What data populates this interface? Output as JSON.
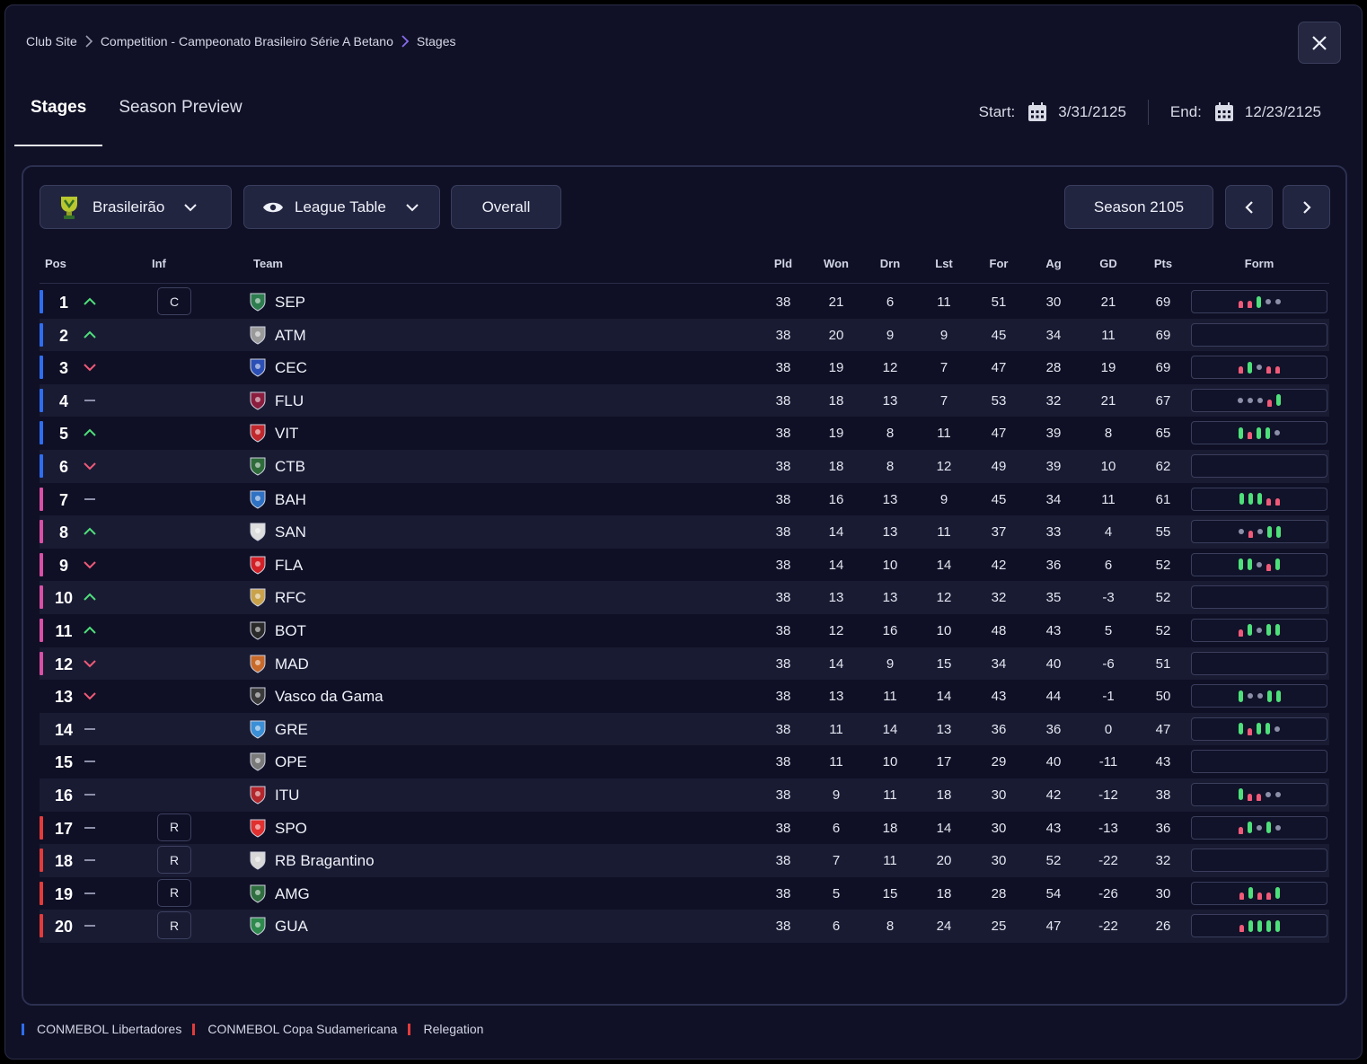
{
  "breadcrumb": [
    "Club Site",
    "Competition - Campeonato Brasileiro Série A Betano",
    "Stages"
  ],
  "tabs": [
    "Stages",
    "Season Preview"
  ],
  "dates": {
    "start_label": "Start:",
    "start": "3/31/2125",
    "end_label": "End:",
    "end": "12/23/2125"
  },
  "controls": {
    "competition": "Brasileirão",
    "view": "League Table",
    "scope": "Overall",
    "season": "Season 2105"
  },
  "columns": {
    "pos": "Pos",
    "inf": "Inf",
    "team": "Team",
    "pld": "Pld",
    "won": "Won",
    "drn": "Drn",
    "lst": "Lst",
    "for": "For",
    "ag": "Ag",
    "gd": "GD",
    "pts": "Pts",
    "form": "Form"
  },
  "colors": {
    "libertadores": "#2f6df0",
    "sudamericana": "#d94fa6",
    "relegation": "#e23b3b",
    "win": "#4ee07a",
    "loss": "#f05a78",
    "draw": "#8c8fa8"
  },
  "rows": [
    {
      "pos": "1",
      "trend": "up",
      "inf": "C",
      "team": "SEP",
      "crest": "#2e7d4f",
      "zone": "lib",
      "pld": "38",
      "won": "21",
      "drn": "6",
      "lst": "11",
      "for": "51",
      "ag": "30",
      "gd": "21",
      "pts": "69",
      "form": "LLWDD"
    },
    {
      "pos": "2",
      "trend": "up",
      "inf": "",
      "team": "ATM",
      "crest": "#9a9a9a",
      "zone": "lib",
      "pld": "38",
      "won": "20",
      "drn": "9",
      "lst": "9",
      "for": "45",
      "ag": "34",
      "gd": "11",
      "pts": "69",
      "form": ""
    },
    {
      "pos": "3",
      "trend": "down",
      "inf": "",
      "team": "CEC",
      "crest": "#2b4fb5",
      "zone": "lib",
      "pld": "38",
      "won": "19",
      "drn": "12",
      "lst": "7",
      "for": "47",
      "ag": "28",
      "gd": "19",
      "pts": "69",
      "form": "LWDLL"
    },
    {
      "pos": "4",
      "trend": "same",
      "inf": "",
      "team": "FLU",
      "crest": "#8b1e3f",
      "zone": "lib",
      "pld": "38",
      "won": "18",
      "drn": "13",
      "lst": "7",
      "for": "53",
      "ag": "32",
      "gd": "21",
      "pts": "67",
      "form": "DDDLW"
    },
    {
      "pos": "5",
      "trend": "up",
      "inf": "",
      "team": "VIT",
      "crest": "#c0282d",
      "zone": "lib",
      "pld": "38",
      "won": "19",
      "drn": "8",
      "lst": "11",
      "for": "47",
      "ag": "39",
      "gd": "8",
      "pts": "65",
      "form": "WLWWD"
    },
    {
      "pos": "6",
      "trend": "down",
      "inf": "",
      "team": "CTB",
      "crest": "#2e6b3a",
      "zone": "lib",
      "pld": "38",
      "won": "18",
      "drn": "8",
      "lst": "12",
      "for": "49",
      "ag": "39",
      "gd": "10",
      "pts": "62",
      "form": ""
    },
    {
      "pos": "7",
      "trend": "same",
      "inf": "",
      "team": "BAH",
      "crest": "#2f72c4",
      "zone": "sud",
      "pld": "38",
      "won": "16",
      "drn": "13",
      "lst": "9",
      "for": "45",
      "ag": "34",
      "gd": "11",
      "pts": "61",
      "form": "WWWLL"
    },
    {
      "pos": "8",
      "trend": "up",
      "inf": "",
      "team": "SAN",
      "crest": "#dddddd",
      "zone": "sud",
      "pld": "38",
      "won": "14",
      "drn": "13",
      "lst": "11",
      "for": "37",
      "ag": "33",
      "gd": "4",
      "pts": "55",
      "form": "DLDWW"
    },
    {
      "pos": "9",
      "trend": "down",
      "inf": "",
      "team": "FLA",
      "crest": "#d32027",
      "zone": "sud",
      "pld": "38",
      "won": "14",
      "drn": "10",
      "lst": "14",
      "for": "42",
      "ag": "36",
      "gd": "6",
      "pts": "52",
      "form": "WWDLW"
    },
    {
      "pos": "10",
      "trend": "up",
      "inf": "",
      "team": "RFC",
      "crest": "#c9a24a",
      "zone": "sud",
      "pld": "38",
      "won": "13",
      "drn": "13",
      "lst": "12",
      "for": "32",
      "ag": "35",
      "gd": "-3",
      "pts": "52",
      "form": ""
    },
    {
      "pos": "11",
      "trend": "up",
      "inf": "",
      "team": "BOT",
      "crest": "#2a2a2a",
      "zone": "sud",
      "pld": "38",
      "won": "12",
      "drn": "16",
      "lst": "10",
      "for": "48",
      "ag": "43",
      "gd": "5",
      "pts": "52",
      "form": "LWDWW"
    },
    {
      "pos": "12",
      "trend": "down",
      "inf": "",
      "team": "MAD",
      "crest": "#c86a2a",
      "zone": "sud",
      "pld": "38",
      "won": "14",
      "drn": "9",
      "lst": "15",
      "for": "34",
      "ag": "40",
      "gd": "-6",
      "pts": "51",
      "form": ""
    },
    {
      "pos": "13",
      "trend": "down",
      "inf": "",
      "team": "Vasco da Gama",
      "crest": "#3a3a3a",
      "zone": "",
      "pld": "38",
      "won": "13",
      "drn": "11",
      "lst": "14",
      "for": "43",
      "ag": "44",
      "gd": "-1",
      "pts": "50",
      "form": "WDDWW"
    },
    {
      "pos": "14",
      "trend": "same",
      "inf": "",
      "team": "GRE",
      "crest": "#3b8fd6",
      "zone": "",
      "pld": "38",
      "won": "11",
      "drn": "14",
      "lst": "13",
      "for": "36",
      "ag": "36",
      "gd": "0",
      "pts": "47",
      "form": "WLWWD"
    },
    {
      "pos": "15",
      "trend": "same",
      "inf": "",
      "team": "OPE",
      "crest": "#7a7a7a",
      "zone": "",
      "pld": "38",
      "won": "11",
      "drn": "10",
      "lst": "17",
      "for": "29",
      "ag": "40",
      "gd": "-11",
      "pts": "43",
      "form": ""
    },
    {
      "pos": "16",
      "trend": "same",
      "inf": "",
      "team": "ITU",
      "crest": "#b3262c",
      "zone": "",
      "pld": "38",
      "won": "9",
      "drn": "11",
      "lst": "18",
      "for": "30",
      "ag": "42",
      "gd": "-12",
      "pts": "38",
      "form": "WLLDD"
    },
    {
      "pos": "17",
      "trend": "same",
      "inf": "R",
      "team": "SPO",
      "crest": "#e03030",
      "zone": "rel",
      "pld": "38",
      "won": "6",
      "drn": "18",
      "lst": "14",
      "for": "30",
      "ag": "43",
      "gd": "-13",
      "pts": "36",
      "form": "LWDWD"
    },
    {
      "pos": "18",
      "trend": "same",
      "inf": "R",
      "team": "RB Bragantino",
      "crest": "#d8d8d8",
      "zone": "rel",
      "pld": "38",
      "won": "7",
      "drn": "11",
      "lst": "20",
      "for": "30",
      "ag": "52",
      "gd": "-22",
      "pts": "32",
      "form": ""
    },
    {
      "pos": "19",
      "trend": "same",
      "inf": "R",
      "team": "AMG",
      "crest": "#2f6e3e",
      "zone": "rel",
      "pld": "38",
      "won": "5",
      "drn": "15",
      "lst": "18",
      "for": "28",
      "ag": "54",
      "gd": "-26",
      "pts": "30",
      "form": "LWLLW"
    },
    {
      "pos": "20",
      "trend": "same",
      "inf": "R",
      "team": "GUA",
      "crest": "#2e8a4d",
      "zone": "rel",
      "pld": "38",
      "won": "6",
      "drn": "8",
      "lst": "24",
      "for": "25",
      "ag": "47",
      "gd": "-22",
      "pts": "26",
      "form": "LWWWW"
    }
  ],
  "legend": [
    {
      "label": "CONMEBOL Libertadores",
      "color": "#2f6df0"
    },
    {
      "label": "CONMEBOL Copa Sudamericana",
      "color": "#e23b3b"
    },
    {
      "label": "Relegation",
      "color": "#e23b3b"
    }
  ]
}
